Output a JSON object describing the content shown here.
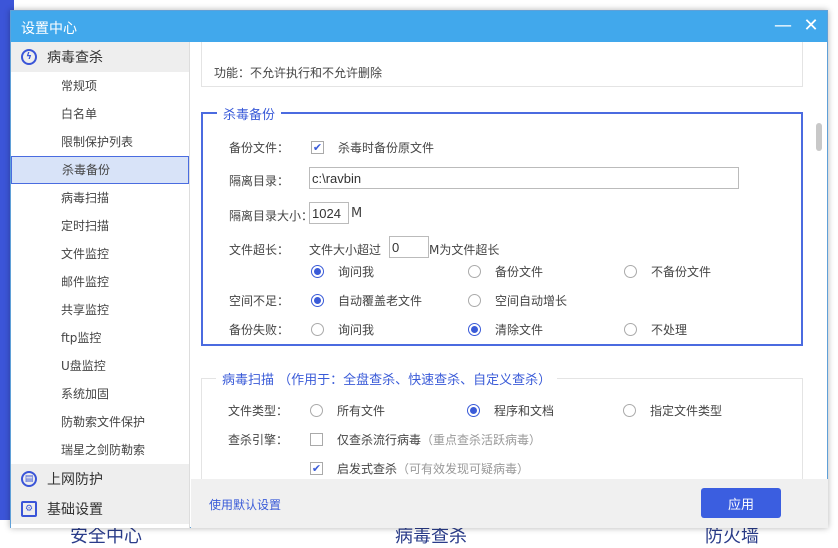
{
  "window": {
    "title": "设置中心",
    "minimize": "—",
    "close": "✕"
  },
  "background": {
    "labels": [
      "安全中心",
      "病毒查杀",
      "防火墙"
    ]
  },
  "sidebar": {
    "groups": [
      {
        "label": "病毒查杀",
        "icon": "virus-scan-icon"
      },
      {
        "label": "上网防护",
        "icon": "web-protect-icon"
      },
      {
        "label": "基础设置",
        "icon": "settings-doc-icon"
      }
    ],
    "items": [
      "常规项",
      "白名单",
      "限制保护列表",
      "杀毒备份",
      "病毒扫描",
      "定时扫描",
      "文件监控",
      "邮件监控",
      "共享监控",
      "ftp监控",
      "U盘监控",
      "系统加固",
      "防勒索文件保护",
      "瑞星之剑防勒索"
    ],
    "selected": "杀毒备份"
  },
  "main": {
    "top_text": "功能：不允许执行和不允许删除",
    "backup": {
      "title": "杀毒备份",
      "backup_file_label": "备份文件：",
      "backup_file_option": "杀毒时备份原文件",
      "quarantine_dir_label": "隔离目录：",
      "quarantine_dir_value": "c:\\ravbin",
      "quarantine_size_label": "隔离目录大小：",
      "quarantine_size_value": "1024",
      "quarantine_size_unit": "M",
      "oversize_label": "文件超长：",
      "oversize_prefix": "文件大小超过",
      "oversize_value": "0",
      "oversize_suffix": "M为文件超长",
      "oversize_options": [
        "询问我",
        "备份文件",
        "不备份文件"
      ],
      "space_label": "空间不足：",
      "space_options": [
        "自动覆盖老文件",
        "空间自动增长"
      ],
      "fail_label": "备份失败：",
      "fail_options": [
        "询问我",
        "清除文件",
        "不处理"
      ]
    },
    "scan": {
      "title": "病毒扫描",
      "scope": "（作用于：全盘查杀、快速查杀、自定义查杀）",
      "filetype_label": "文件类型：",
      "filetype_options": [
        "所有文件",
        "程序和文档",
        "指定文件类型"
      ],
      "engine_label": "查杀引擎：",
      "engine_opt1": "仅查杀流行病毒",
      "engine_opt1_hint": "（重点查杀活跃病毒）",
      "engine_opt2": "启发式查杀",
      "engine_opt2_hint": "（可有效发现可疑病毒）"
    }
  },
  "footer": {
    "default_link": "使用默认设置",
    "apply": "应用"
  }
}
